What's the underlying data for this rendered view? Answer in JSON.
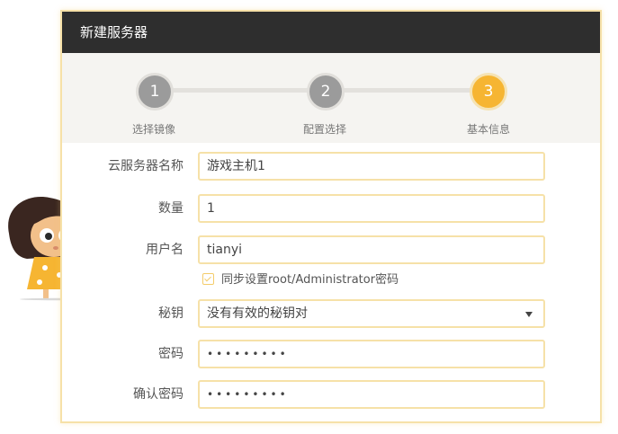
{
  "dialog": {
    "title": "新建服务器"
  },
  "steps": [
    {
      "number": "1",
      "label": "选择镜像",
      "state": "done"
    },
    {
      "number": "2",
      "label": "配置选择",
      "state": "done"
    },
    {
      "number": "3",
      "label": "基本信息",
      "state": "active"
    }
  ],
  "form": {
    "server_name": {
      "label": "云服务器名称",
      "value": "游戏主机1"
    },
    "quantity": {
      "label": "数量",
      "value": "1"
    },
    "username": {
      "label": "用户名",
      "value": "tianyi"
    },
    "sync_checkbox": {
      "label": "同步设置root/Administrator密码",
      "checked": true
    },
    "key": {
      "label": "秘钥",
      "value": "没有有效的秘钥对"
    },
    "password": {
      "label": "密码",
      "value": "•••••••••"
    },
    "confirm_password": {
      "label": "确认密码",
      "value": "•••••••••"
    }
  },
  "colors": {
    "accent": "#f6b532",
    "header": "#2e2e2e",
    "border": "#f6e1a8",
    "step_done": "#9b9b9b"
  },
  "mascot": {
    "icon": "girl-mascot-illustration"
  }
}
